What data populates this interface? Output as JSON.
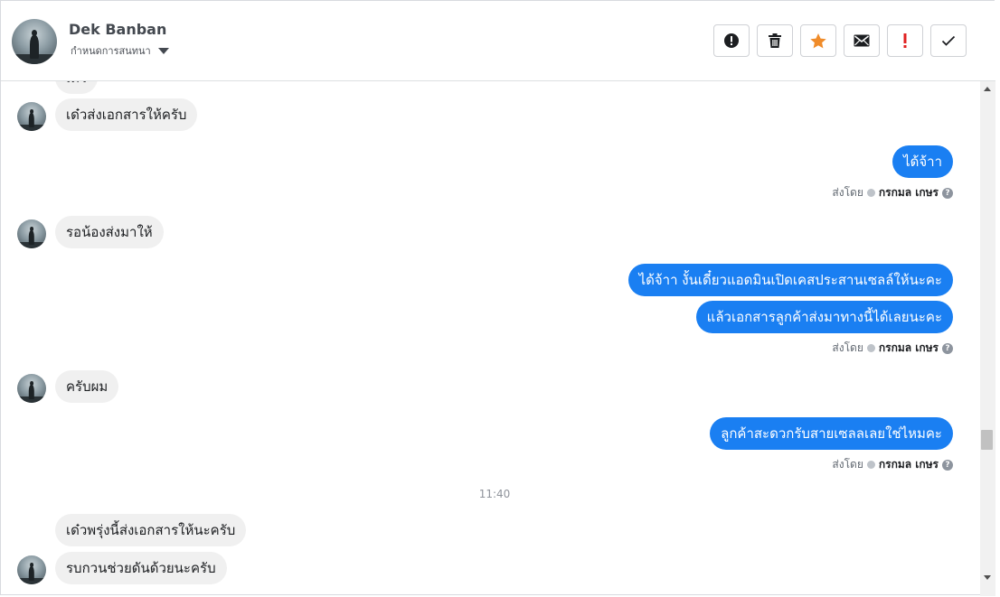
{
  "header": {
    "contact_name": "Dek Banban",
    "assign_label": "กำหนดการสนทนา",
    "toolbar": [
      {
        "icon": "alert-circle-icon",
        "name": "mark-spam-button"
      },
      {
        "icon": "trash-icon",
        "name": "delete-button"
      },
      {
        "icon": "star-icon",
        "name": "star-button"
      },
      {
        "icon": "envelope-icon",
        "name": "mark-unread-button"
      },
      {
        "icon": "exclamation-icon",
        "name": "important-button"
      },
      {
        "icon": "check-icon",
        "name": "mark-done-button"
      }
    ]
  },
  "colors": {
    "outgoing_bubble": "#1a7ff2",
    "incoming_bubble": "#f0f0f0",
    "star": "#f08c2a",
    "important": "#e02020"
  },
  "messages": {
    "in_partial": "เดว",
    "in_1": "เด๋วส่งเอกสารให้ครับ",
    "out_1": "ได้จ้าา",
    "in_2": "รอน้องส่งมาให้",
    "out_2a": "ได้จ้าา งั้นเดี๋ยวแอดมินเปิดเคสประสานเซลล์ให้นะคะ",
    "out_2b": "แล้วเอกสารลูกค้าส่งมาทางนี้ได้เลยนะคะ",
    "in_3": "ครับผม",
    "out_3": "ลูกค้าสะดวกรับสายเซลลเลยใช่ไหมคะ",
    "time_divider": "11:40",
    "in_4a": "เด๋วพรุ่งนี้ส่งเอกสารให้นะครับ",
    "in_4b": "รบกวนช่วยดันด้วยนะครับ"
  },
  "sent_by": {
    "prefix": "ส่งโดย",
    "agent": "กรกมล เกษร",
    "help": "?"
  }
}
